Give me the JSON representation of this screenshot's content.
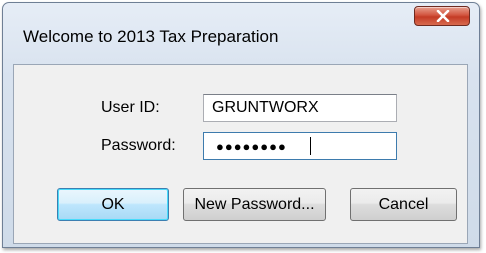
{
  "window": {
    "title": "Welcome to 2013 Tax Preparation"
  },
  "form": {
    "user_id_label": "User ID:",
    "user_id_value": "GRUNTWORX",
    "password_label": "Password:",
    "password_mask": "●●●●●●●●"
  },
  "buttons": {
    "ok": "OK",
    "new_password": "New Password...",
    "cancel": "Cancel"
  },
  "colors": {
    "close_button": "#c43b25",
    "default_button_border": "#3c7fb1"
  },
  "icons": {
    "close": "close-icon"
  }
}
